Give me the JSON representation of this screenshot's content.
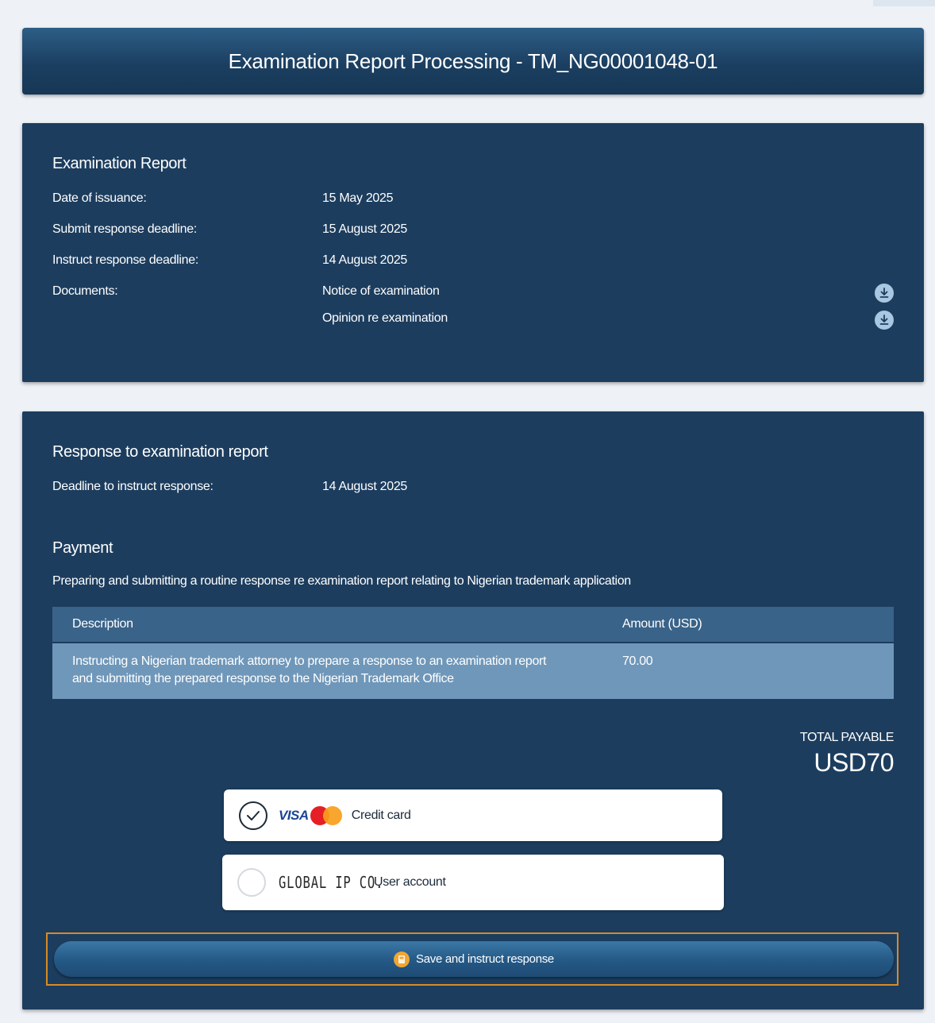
{
  "header": {
    "title": "Examination Report Processing - TM_NG00001048-01"
  },
  "report": {
    "title": "Examination Report",
    "rows": [
      {
        "label": "Date of issuance:",
        "value": "15 May 2025"
      },
      {
        "label": "Submit response deadline:",
        "value": "15 August 2025"
      },
      {
        "label": "Instruct response deadline:",
        "value": "14 August 2025"
      }
    ],
    "documents_label": "Documents:",
    "documents": [
      {
        "name": "Notice of examination",
        "icon": "download-icon"
      },
      {
        "name": "Opinion re examination",
        "icon": "download-icon"
      }
    ]
  },
  "response": {
    "title": "Response to examination report",
    "deadline_label": "Deadline to instruct response:",
    "deadline_value": "14 August 2025"
  },
  "payment": {
    "title": "Payment",
    "description": "Preparing and submitting a routine response re examination report relating to Nigerian trademark application",
    "table": {
      "headers": [
        "Description",
        "Amount (USD)"
      ],
      "rows": [
        {
          "description_line1": "Instructing a Nigerian trademark attorney to prepare a response to an examination report",
          "description_line2": "and submitting the prepared response to the Nigerian Trademark Office",
          "amount": "70.00"
        }
      ]
    },
    "total_label": "TOTAL PAYABLE",
    "total_value": "USD70",
    "options": [
      {
        "label": "Credit card",
        "selected": true,
        "logo_visa": "VISA",
        "logo_mc": "MasterCard"
      },
      {
        "label": "User account",
        "selected": false,
        "logo_text": "GLOBAL IP CO."
      }
    ]
  },
  "actions": {
    "submit_label": "Save and instruct response"
  },
  "colors": {
    "panel": "#1c3d5e",
    "accent_border": "#d98a24",
    "table_header": "#3a6389",
    "table_row": "#6f97b9"
  }
}
